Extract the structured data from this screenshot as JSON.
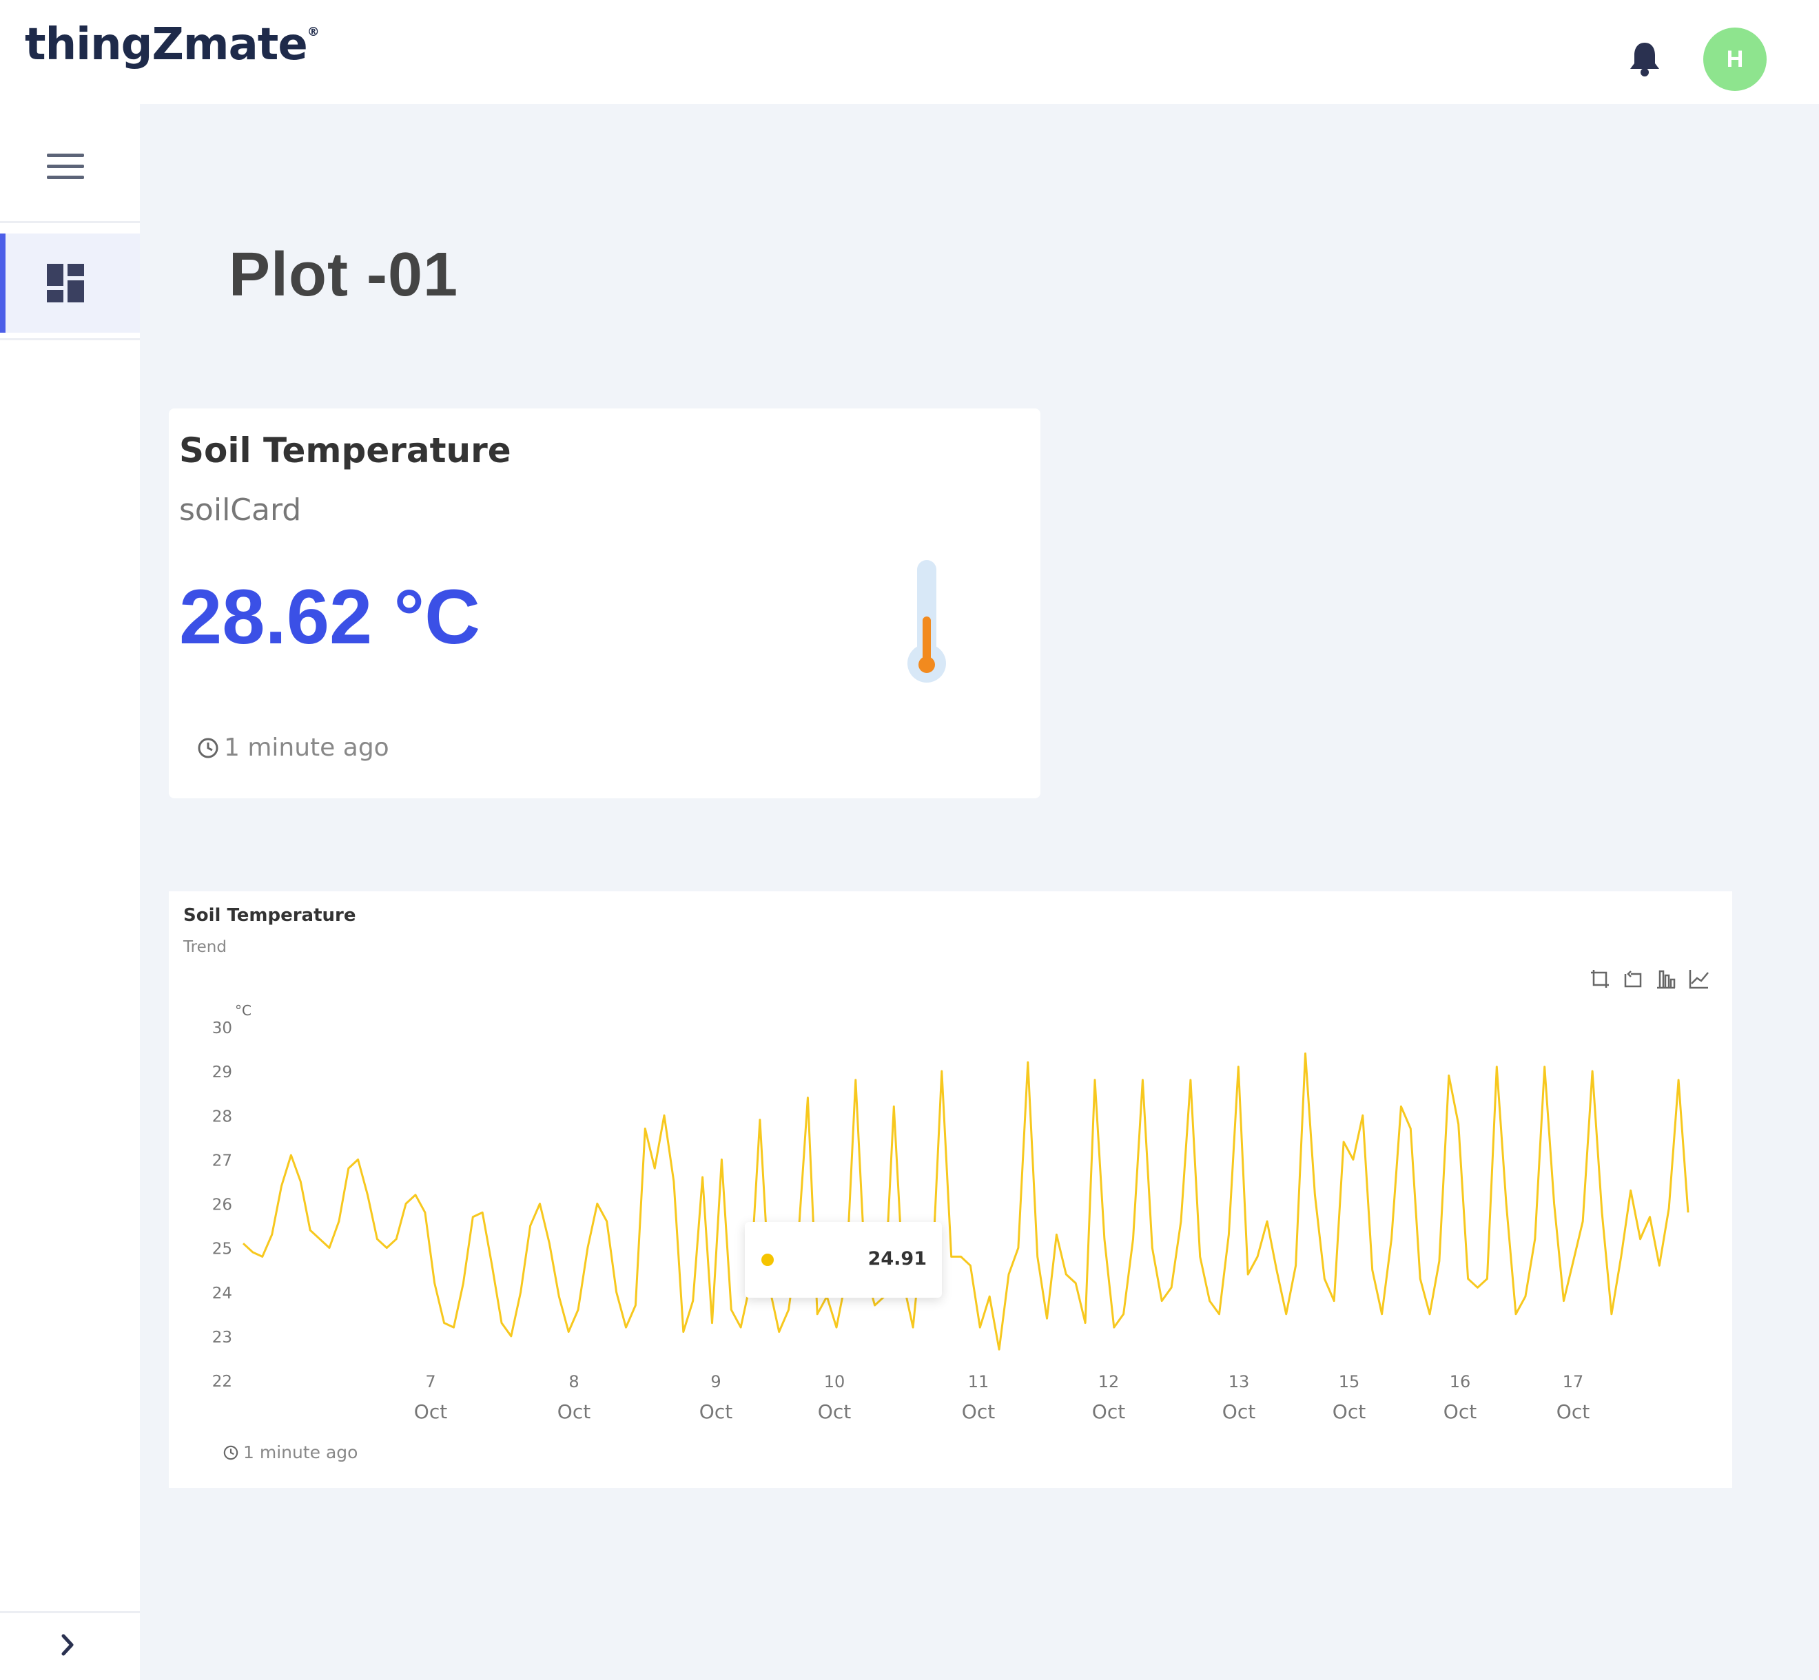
{
  "header": {
    "logo_text": "thingZmate",
    "logo_mark": "®",
    "notification_icon": "bell-icon",
    "avatar_initial": "H",
    "avatar_color": "#8ee48e"
  },
  "sidebar": {
    "menu_icon": "hamburger-icon",
    "items": [
      {
        "icon": "dashboard-icon",
        "active": true
      }
    ],
    "expand_icon": "chevron-right-icon",
    "accent_color": "#4c5ee8"
  },
  "page": {
    "title": "Plot -01"
  },
  "value_card": {
    "title": "Soil Temperature",
    "subtitle": "soilCard",
    "value": "28.62 °C",
    "icon": "thermometer-icon",
    "updated": "1 minute ago",
    "value_color": "#3b50e6"
  },
  "trend_card": {
    "title": "Soil Temperature",
    "subtitle": "Trend",
    "updated": "1 minute ago",
    "toolbar": [
      "zoom-in-icon",
      "zoom-reset-icon",
      "bar-chart-icon",
      "line-chart-icon"
    ],
    "tooltip_value": "24.91"
  },
  "chart_data": {
    "type": "line",
    "title": "Soil Temperature",
    "ylabel": "°C",
    "ylim": [
      22,
      30
    ],
    "yticks": [
      "30",
      "29",
      "28",
      "27",
      "26",
      "25",
      "24",
      "23",
      "22"
    ],
    "xticks": [
      {
        "day": "7",
        "month": "Oct"
      },
      {
        "day": "8",
        "month": "Oct"
      },
      {
        "day": "9",
        "month": "Oct"
      },
      {
        "day": "10",
        "month": "Oct"
      },
      {
        "day": "11",
        "month": "Oct"
      },
      {
        "day": "12",
        "month": "Oct"
      },
      {
        "day": "13",
        "month": "Oct"
      },
      {
        "day": "15",
        "month": "Oct"
      },
      {
        "day": "16",
        "month": "Oct"
      },
      {
        "day": "17",
        "month": "Oct"
      }
    ],
    "line_color": "#f7c81e",
    "series": [
      {
        "values": [
          25.1,
          24.9,
          24.8,
          25.3,
          26.4,
          27.1,
          26.5,
          25.4,
          25.2,
          25.0,
          25.6,
          26.8,
          27.0,
          26.2,
          25.2,
          25.0,
          25.2,
          26.0,
          26.2,
          25.8,
          24.2,
          23.3,
          23.2,
          24.2,
          25.7,
          25.8,
          24.6,
          23.3,
          23.0,
          24.0,
          25.5,
          26.0,
          25.1,
          23.9,
          23.1,
          23.6,
          25.0,
          26.0,
          25.6,
          24.0,
          23.2,
          23.7,
          27.7,
          26.8,
          28.0,
          26.5,
          23.1,
          23.8,
          26.6,
          23.3,
          27.0,
          23.6,
          23.2,
          24.2,
          27.9,
          24.1,
          23.1,
          23.6,
          25.2,
          28.4,
          23.5,
          23.9,
          23.2,
          24.3,
          28.8,
          24.5,
          23.7,
          23.9,
          28.2,
          24.2,
          23.2,
          25.4,
          24.4,
          29.0,
          24.8,
          24.8,
          24.6,
          23.2,
          23.9,
          22.7,
          24.4,
          25.0,
          29.2,
          24.8,
          23.4,
          25.3,
          24.4,
          24.2,
          23.3,
          28.8,
          25.2,
          23.2,
          23.5,
          25.2,
          28.8,
          25.0,
          23.8,
          24.1,
          25.6,
          28.8,
          24.8,
          23.8,
          23.5,
          25.3,
          29.1,
          24.4,
          24.8,
          25.6,
          24.5,
          23.5,
          24.6,
          29.4,
          26.2,
          24.3,
          23.8,
          27.4,
          27.0,
          28.0,
          24.5,
          23.5,
          25.2,
          28.2,
          27.7,
          24.3,
          23.5,
          24.7,
          28.9,
          27.8,
          24.3,
          24.1,
          24.3,
          29.1,
          26.0,
          23.5,
          23.9,
          25.2,
          29.1,
          26.0,
          23.8,
          24.7,
          25.6,
          29.0,
          25.8,
          23.5,
          24.8,
          26.3,
          25.2,
          25.7,
          24.6,
          25.9,
          28.8,
          25.8
        ]
      }
    ]
  }
}
